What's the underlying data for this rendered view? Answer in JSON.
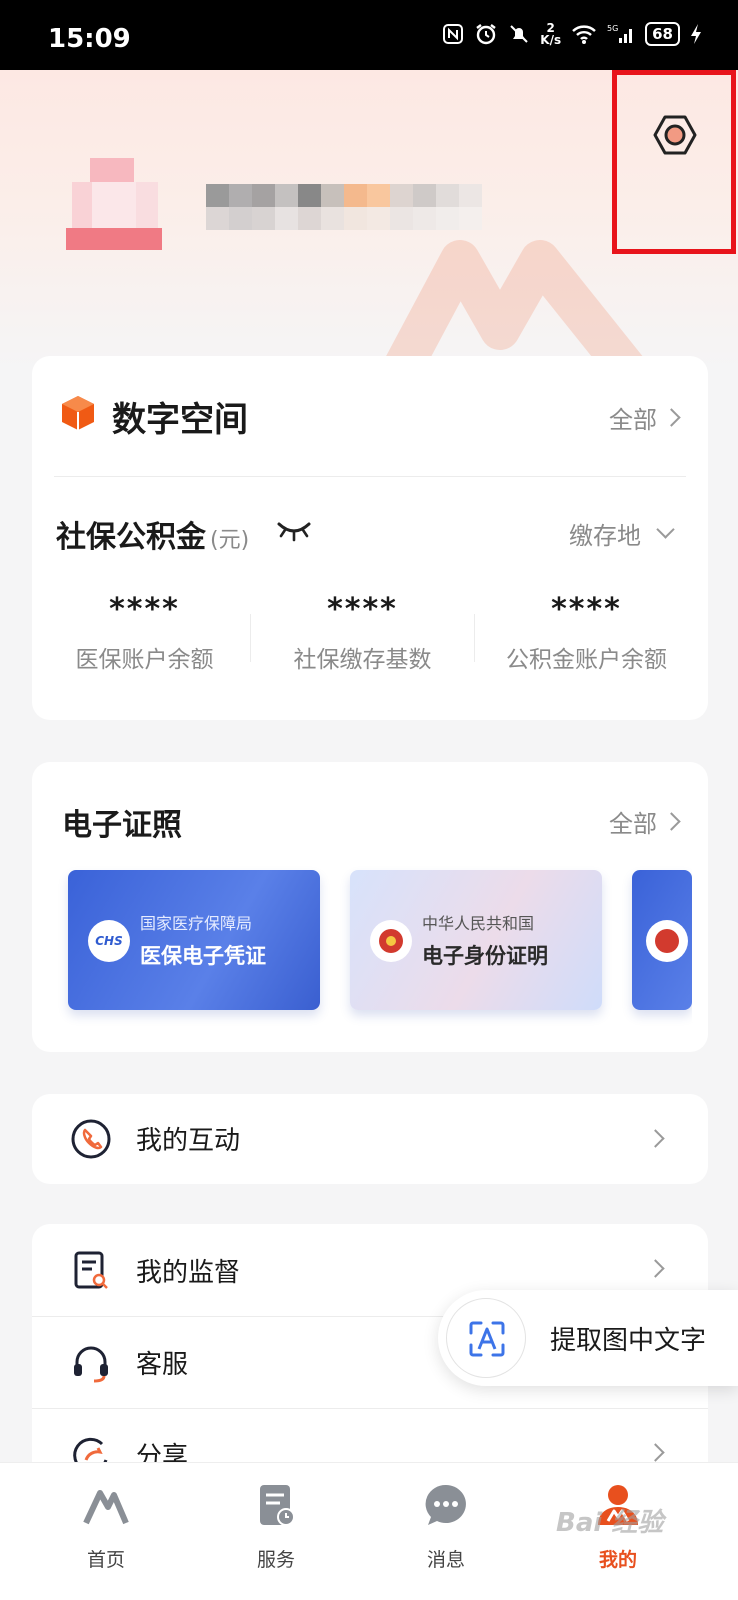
{
  "status_bar": {
    "time": "15:09",
    "net_speed_top": "2",
    "net_speed_unit": "K/s",
    "battery": "68"
  },
  "profile": {
    "settings_icon": "settings-hexagon-icon"
  },
  "digital_space": {
    "title": "数字空间",
    "more_label": "全部",
    "section_title": "社保公积金",
    "unit": "(元)",
    "region_label": "缴存地",
    "stats": [
      {
        "value": "****",
        "label": "医保账户余额"
      },
      {
        "value": "****",
        "label": "社保缴存基数"
      },
      {
        "value": "****",
        "label": "公积金账户余额"
      }
    ]
  },
  "licenses": {
    "title": "电子证照",
    "more_label": "全部",
    "items": [
      {
        "sub": "国家医疗保障局",
        "main": "医保电子凭证"
      },
      {
        "sub": "中华人民共和国",
        "main": "电子身份证明"
      }
    ]
  },
  "interaction": {
    "label": "我的互动"
  },
  "menu": {
    "items": [
      {
        "label": "我的监督"
      },
      {
        "label": "客服"
      },
      {
        "label": "分享"
      }
    ]
  },
  "ocr": {
    "label": "提取图中文字"
  },
  "tabbar": {
    "items": [
      {
        "label": "首页"
      },
      {
        "label": "服务"
      },
      {
        "label": "消息"
      },
      {
        "label": "我的"
      }
    ]
  },
  "watermark": "Bai 经验",
  "colors": {
    "accent": "#e8501e",
    "highlight_box": "#e8141b",
    "card_blue": "#3a62d8"
  }
}
